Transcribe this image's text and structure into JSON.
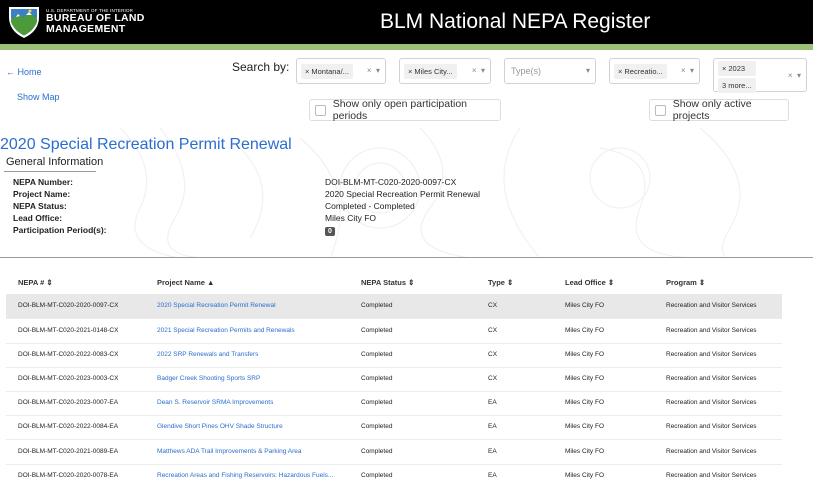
{
  "header": {
    "agency_small": "U.S. DEPARTMENT OF THE INTERIOR",
    "agency_line1": "BUREAU OF LAND",
    "agency_line2": "MANAGEMENT",
    "title": "BLM National NEPA Register"
  },
  "nav": {
    "home": "← Home",
    "show_map": "Show Map"
  },
  "search": {
    "label": "Search by:",
    "state_chip": "Montana/...",
    "office_chip": "Miles City...",
    "type_placeholder": "Type(s)",
    "program_chip": "Recreatio...",
    "year_chip": "2023",
    "year_more": "3 more...",
    "open_periods_label": "Show only open participation periods",
    "active_projects_label": "Show only active projects"
  },
  "detail": {
    "title": "2020 Special Recreation Permit Renewal",
    "section": "General Information",
    "fields": [
      {
        "label": "NEPA Number:",
        "value": "DOI-BLM-MT-C020-2020-0097-CX"
      },
      {
        "label": "Project Name:",
        "value": "2020 Special Recreation Permit Renewal"
      },
      {
        "label": "NEPA Status:",
        "value": "Completed - Completed"
      },
      {
        "label": "Lead Office:",
        "value": "Miles City FO"
      },
      {
        "label": "Participation Period(s):",
        "value": "0"
      }
    ]
  },
  "table": {
    "headers": {
      "nepa": "NEPA # ⇕",
      "name": "Project Name ▲",
      "status": "NEPA Status ⇕",
      "type": "Type ⇕",
      "office": "Lead Office ⇕",
      "program": "Program ⇕"
    },
    "rows": [
      {
        "nepa": "DOI-BLM-MT-C020-2020-0097-CX",
        "name": "2020 Special Recreation Permit Renewal",
        "status": "Completed",
        "type": "CX",
        "office": "Miles City FO",
        "program": "Recreation and Visitor Services"
      },
      {
        "nepa": "DOI-BLM-MT-C020-2021-0148-CX",
        "name": "2021 Special Recreation Permits and Renewals",
        "status": "Completed",
        "type": "CX",
        "office": "Miles City FO",
        "program": "Recreation and Visitor Services"
      },
      {
        "nepa": "DOI-BLM-MT-C020-2022-0083-CX",
        "name": "2022 SRP Renewals and Transfers",
        "status": "Completed",
        "type": "CX",
        "office": "Miles City FO",
        "program": "Recreation and Visitor Services"
      },
      {
        "nepa": "DOI-BLM-MT-C020-2023-0003-CX",
        "name": "Badger Creek Shooting Sports SRP",
        "status": "Completed",
        "type": "CX",
        "office": "Miles City FO",
        "program": "Recreation and Visitor Services"
      },
      {
        "nepa": "DOI-BLM-MT-C020-2023-0007-EA",
        "name": "Dean S. Reservoir SRMA Improvements",
        "status": "Completed",
        "type": "EA",
        "office": "Miles City FO",
        "program": "Recreation and Visitor Services"
      },
      {
        "nepa": "DOI-BLM-MT-C020-2022-0084-EA",
        "name": "Glendive Short Pines OHV Shade Structure",
        "status": "Completed",
        "type": "EA",
        "office": "Miles City FO",
        "program": "Recreation and Visitor Services"
      },
      {
        "nepa": "DOI-BLM-MT-C020-2021-0089-EA",
        "name": "Matthews ADA Trail Improvements & Parking Area",
        "status": "Completed",
        "type": "EA",
        "office": "Miles City FO",
        "program": "Recreation and Visitor Services"
      },
      {
        "nepa": "DOI-BLM-MT-C020-2020-0078-EA",
        "name": "Recreation Areas and Fishing Reservoirs: Hazardous Fuels...",
        "status": "Completed",
        "type": "EA",
        "office": "Miles City FO",
        "program": "Recreation and Visitor Services"
      }
    ]
  },
  "colors": {
    "header_bg": "#000000",
    "accent_green": "#9bc179",
    "link_blue": "#2a6ecf"
  }
}
